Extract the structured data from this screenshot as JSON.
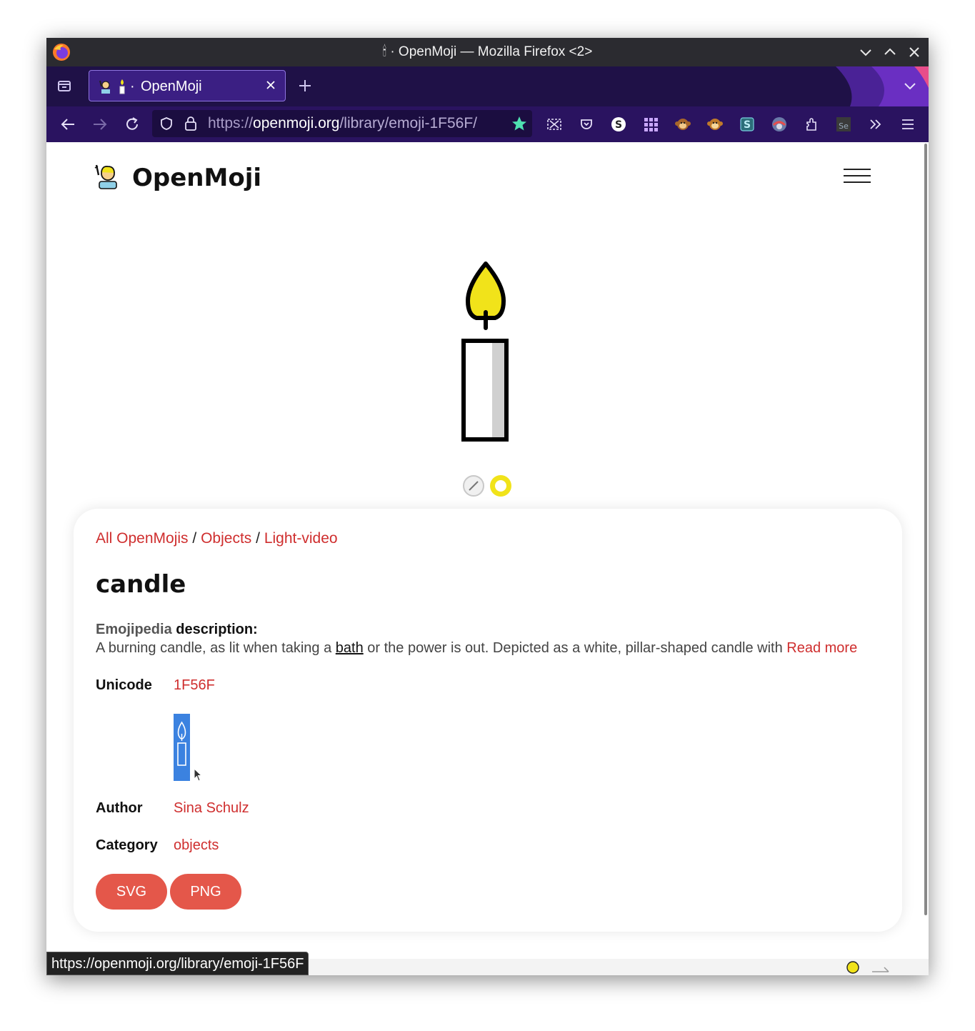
{
  "window": {
    "title": "🕯 · OpenMoji — Mozilla Firefox <2>"
  },
  "tab": {
    "dot": "·",
    "label": "OpenMoji"
  },
  "url": {
    "scheme": "https://",
    "host": "openmoji.org",
    "path": "/library/emoji-1F56F/"
  },
  "site": {
    "name": "OpenMoji"
  },
  "emoji": {
    "name": "candle",
    "breadcrumbs": [
      "All OpenMojis",
      "Objects",
      "Light-video"
    ],
    "crumb_sep": "/",
    "desc_source": "Emojipedia",
    "desc_label": "description:",
    "desc_before": "A burning candle, as lit when taking a ",
    "desc_link": "bath",
    "desc_after": " or the power is out. Depicted as a white, pillar-shaped candle with ",
    "read_more": "Read more",
    "unicode_label": "Unicode",
    "unicode_value": "1F56F",
    "author_label": "Author",
    "author_value": "Sina Schulz",
    "category_label": "Category",
    "category_value": "objects"
  },
  "downloads": {
    "svg_label": "SVG",
    "png_label": "PNG"
  },
  "status_bar": {
    "url": "https://openmoji.org/library/emoji-1F56F"
  },
  "colors": {
    "accent_link": "#cf2e2e",
    "button_bg": "#e4574a",
    "candle_flame": "#f1e31a",
    "selection": "#3b82e0"
  }
}
